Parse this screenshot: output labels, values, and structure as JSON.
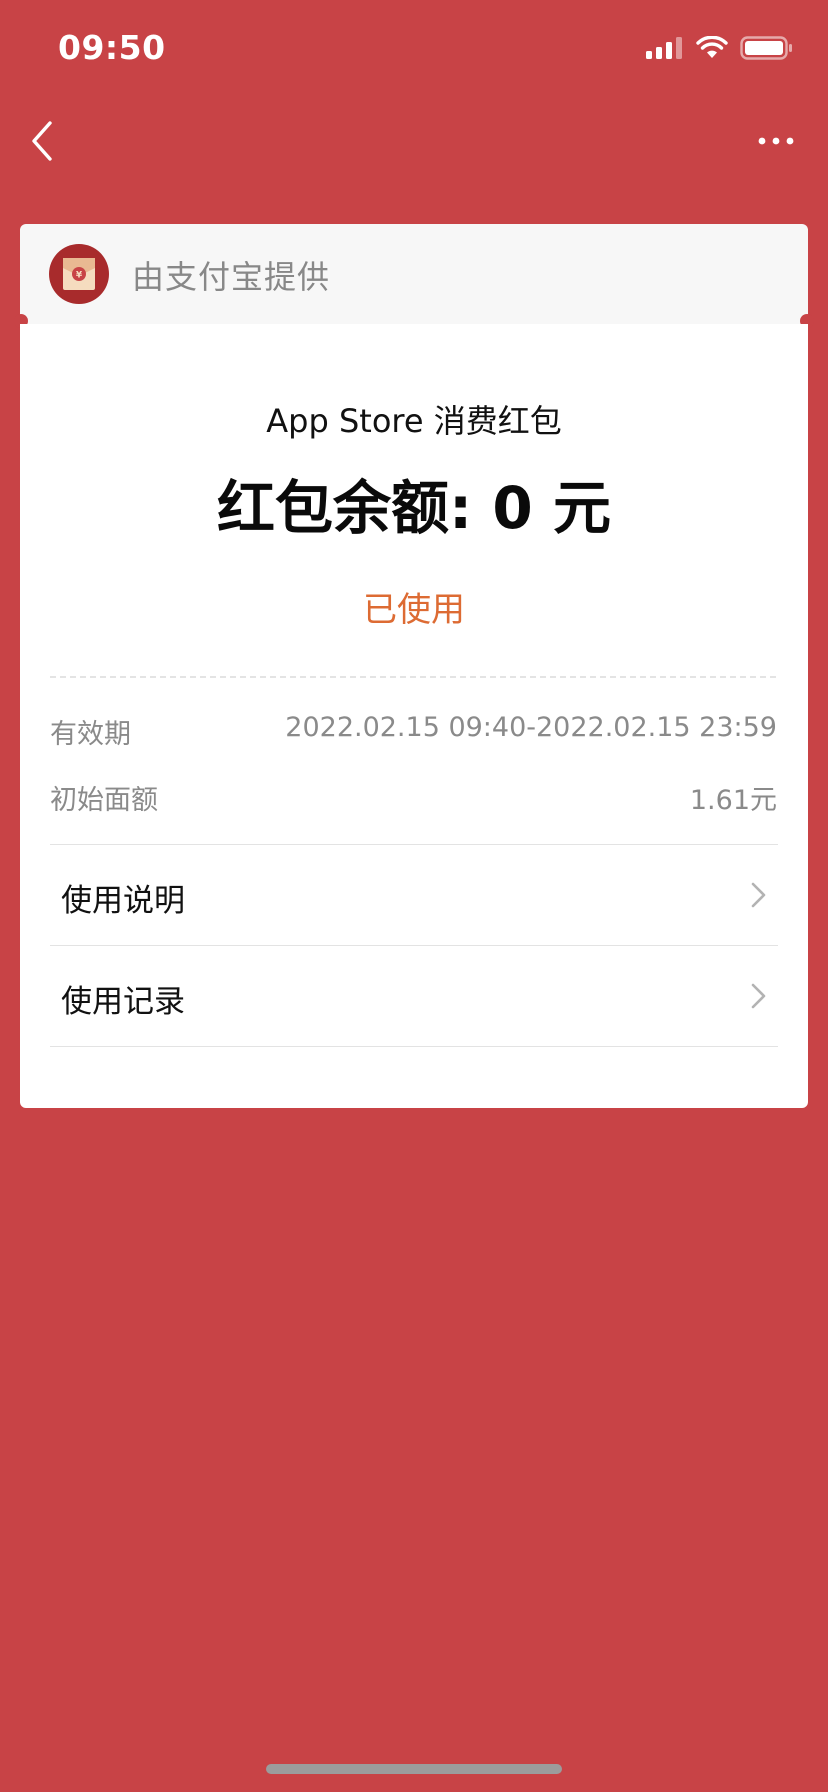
{
  "status_bar": {
    "time": "09:50",
    "icons": [
      "signal-icon",
      "wifi-icon",
      "battery-icon"
    ]
  },
  "nav": {
    "back_icon": "chevron-left-icon",
    "more_icon": "more-dots-icon"
  },
  "card": {
    "provider_icon": "red-envelope-icon",
    "provider_text": "由支付宝提供",
    "store_title": "App Store 消费红包",
    "balance": "红包余额: 0 元",
    "status": "已使用",
    "info": [
      {
        "label": "有效期",
        "value": "2022.02.15 09:40-2022.02.15 23:59"
      },
      {
        "label": "初始面额",
        "value": "1.61元"
      }
    ],
    "menu": [
      {
        "label": "使用说明",
        "icon": "chevron-right-icon"
      },
      {
        "label": "使用记录",
        "icon": "chevron-right-icon"
      }
    ]
  },
  "colors": {
    "background": "#c84346",
    "status_accent": "#dd6b33",
    "card": "#ffffff",
    "card_header": "#f7f7f7"
  }
}
